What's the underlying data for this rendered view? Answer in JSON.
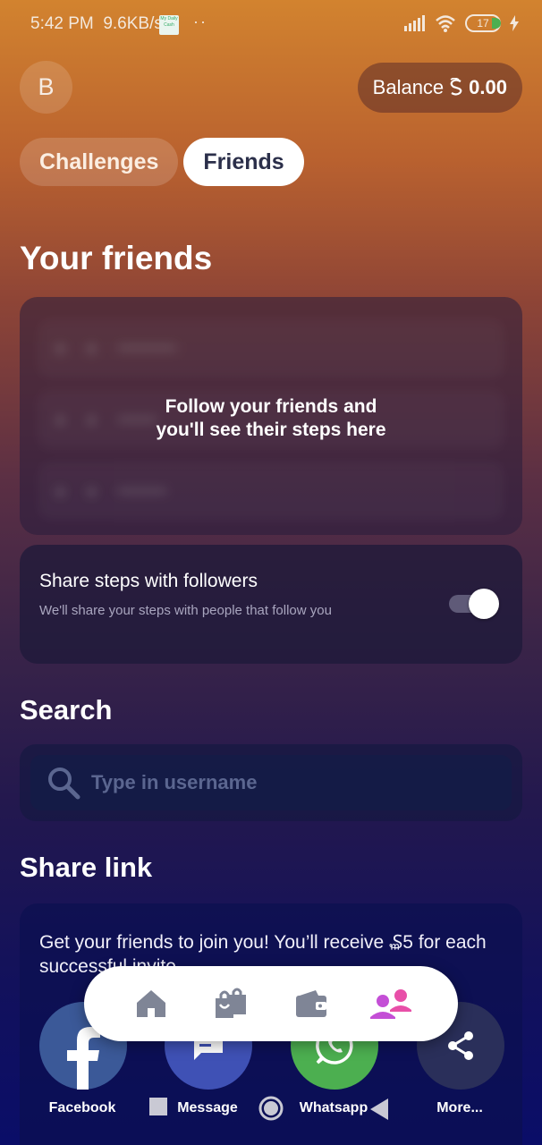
{
  "status_bar": {
    "time": "5:42 PM",
    "speed": "9.6KB/s",
    "app_icon_text": "My Daily Cash",
    "battery": "17"
  },
  "header": {
    "avatar_letter": "B",
    "balance_label": "Balance",
    "balance_currency_icon": "sweatcoin-icon",
    "balance_value": "0.00"
  },
  "tabs": [
    {
      "label": "Challenges",
      "active": false
    },
    {
      "label": "Friends",
      "active": true
    }
  ],
  "friends": {
    "title": "Your friends",
    "empty_message_line1": "Follow your friends and",
    "empty_message_line2": "you'll see their steps here"
  },
  "share_steps": {
    "title": "Share steps with followers",
    "description": "We'll share your steps with people that follow you",
    "enabled": true
  },
  "search": {
    "title": "Search",
    "placeholder": "Type in username"
  },
  "share_link": {
    "title": "Share link",
    "description": "Get your friends to join you! You’ll receive ₷5 for each successful invite",
    "options": [
      {
        "label": "Facebook",
        "icon": "facebook-icon",
        "color": "#3b5998"
      },
      {
        "label": "Message",
        "icon": "message-icon",
        "color": "#3f51b5"
      },
      {
        "label": "Whatsapp",
        "icon": "whatsapp-icon",
        "color": "#4caf50"
      },
      {
        "label": "More...",
        "icon": "share-icon",
        "color": "#2a2f5a"
      }
    ]
  },
  "bottom_nav": [
    {
      "name": "home",
      "icon": "home-icon",
      "active": false
    },
    {
      "name": "shop",
      "icon": "shopping-bags-icon",
      "active": false
    },
    {
      "name": "wallet",
      "icon": "wallet-icon",
      "active": false
    },
    {
      "name": "friends",
      "icon": "friends-icon",
      "active": true
    }
  ],
  "colors": {
    "accent": "#c44fd6",
    "nav_inactive": "#7f8596"
  }
}
